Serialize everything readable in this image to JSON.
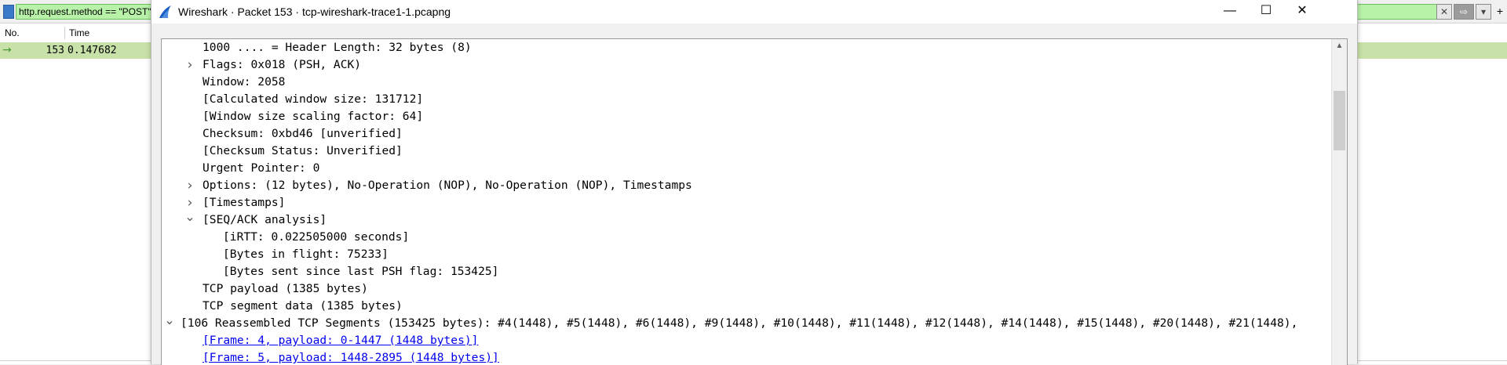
{
  "main_window": {
    "filter_text": "http.request.method == \"POST\"",
    "filter_bookmark_icon": "bookmark-icon",
    "filter_controls": {
      "clear_icon": "✕",
      "apply_icon": "⇨",
      "dropdown_icon": "▾",
      "add_icon": "+"
    },
    "columns": {
      "no": "No.",
      "time": "Time"
    },
    "selected_packet": {
      "marker": "→",
      "no": "153",
      "time": "0.147682"
    },
    "row_color": "#c8e1a8",
    "filter_valid_color": "#b8f2a8"
  },
  "dialog": {
    "title": "Wireshark · Packet 153 · tcp-wireshark-trace1-1.pcapng",
    "logo_icon": "wireshark-fin-icon",
    "window_controls": {
      "minimize": "—",
      "maximize": "☐",
      "close": "✕"
    },
    "tree": [
      {
        "text": "1000 .... = Header Length: 32 bytes (8)",
        "indent": 1,
        "expander": "none",
        "link": false
      },
      {
        "text": "Flags: 0x018 (PSH, ACK)",
        "indent": 1,
        "expander": "collapsed",
        "link": false
      },
      {
        "text": "Window: 2058",
        "indent": 1,
        "expander": "none",
        "link": false
      },
      {
        "text": "[Calculated window size: 131712]",
        "indent": 1,
        "expander": "none",
        "link": false
      },
      {
        "text": "[Window size scaling factor: 64]",
        "indent": 1,
        "expander": "none",
        "link": false
      },
      {
        "text": "Checksum: 0xbd46 [unverified]",
        "indent": 1,
        "expander": "none",
        "link": false
      },
      {
        "text": "[Checksum Status: Unverified]",
        "indent": 1,
        "expander": "none",
        "link": false
      },
      {
        "text": "Urgent Pointer: 0",
        "indent": 1,
        "expander": "none",
        "link": false
      },
      {
        "text": "Options: (12 bytes), No-Operation (NOP), No-Operation (NOP), Timestamps",
        "indent": 1,
        "expander": "collapsed",
        "link": false
      },
      {
        "text": "[Timestamps]",
        "indent": 1,
        "expander": "collapsed",
        "link": false
      },
      {
        "text": "[SEQ/ACK analysis]",
        "indent": 1,
        "expander": "expanded",
        "link": false
      },
      {
        "text": "[iRTT: 0.022505000 seconds]",
        "indent": 2,
        "expander": "none",
        "link": false
      },
      {
        "text": "[Bytes in flight: 75233]",
        "indent": 2,
        "expander": "none",
        "link": false
      },
      {
        "text": "[Bytes sent since last PSH flag: 153425]",
        "indent": 2,
        "expander": "none",
        "link": false
      },
      {
        "text": "TCP payload (1385 bytes)",
        "indent": 1,
        "expander": "none",
        "link": false
      },
      {
        "text": "TCP segment data (1385 bytes)",
        "indent": 1,
        "expander": "none",
        "link": false
      },
      {
        "text": "[106 Reassembled TCP Segments (153425 bytes): #4(1448), #5(1448), #6(1448), #9(1448), #10(1448), #11(1448), #12(1448), #14(1448), #15(1448), #20(1448), #21(1448),",
        "indent": 0,
        "expander": "expanded",
        "link": false
      },
      {
        "text": "[Frame: 4, payload: 0-1447 (1448 bytes)]",
        "indent": 1,
        "expander": "none",
        "link": true
      },
      {
        "text": "[Frame: 5, payload: 1448-2895 (1448 bytes)]",
        "indent": 1,
        "expander": "none",
        "link": true
      }
    ],
    "scrollbar": {
      "up_arrow": "▲",
      "position_fraction": 0.12,
      "visible_fraction": 0.18
    }
  }
}
